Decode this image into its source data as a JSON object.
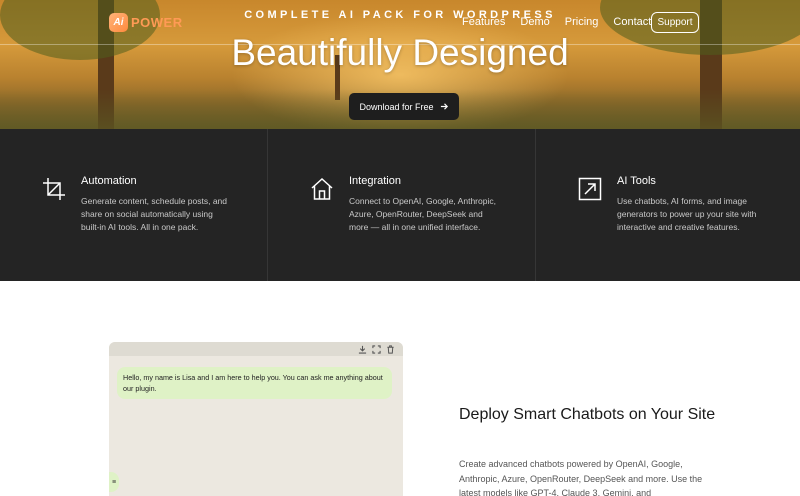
{
  "header": {
    "logo_mark": "Ai",
    "logo_text": "POWER",
    "eyebrow": "COMPLETE AI PACK FOR WORDPRESS",
    "nav": [
      "Features",
      "Demo",
      "Pricing",
      "Contact"
    ],
    "support_label": "Support"
  },
  "hero": {
    "title": "Beautifully Designed",
    "cta_label": "Download for Free"
  },
  "features": [
    {
      "icon": "crop-icon",
      "title": "Automation",
      "text": "Generate content, schedule posts, and share on social automatically using built-in AI tools. All in one pack."
    },
    {
      "icon": "home-icon",
      "title": "Integration",
      "text": "Connect to OpenAI, Google, Anthropic, Azure, OpenRouter, DeepSeek and more — all in one unified interface."
    },
    {
      "icon": "expand-icon",
      "title": "AI Tools",
      "text": "Use chatbots, AI forms, and image generators to power up your site with interactive and creative features."
    }
  ],
  "chat": {
    "message": "Hello, my name is Lisa and I am here to help you. You can ask me anything about our plugin.",
    "handle_glyph": "≡"
  },
  "deploy": {
    "title": "Deploy Smart Chatbots on Your Site",
    "text": "Create advanced chatbots powered by OpenAI, Google, Anthropic, Azure, OpenRouter, DeepSeek and more. Use the latest models like GPT-4, Claude 3, Gemini, and"
  },
  "colors": {
    "accent": "#ff9a55",
    "dark": "#242424",
    "bubble": "#dff2c6"
  }
}
